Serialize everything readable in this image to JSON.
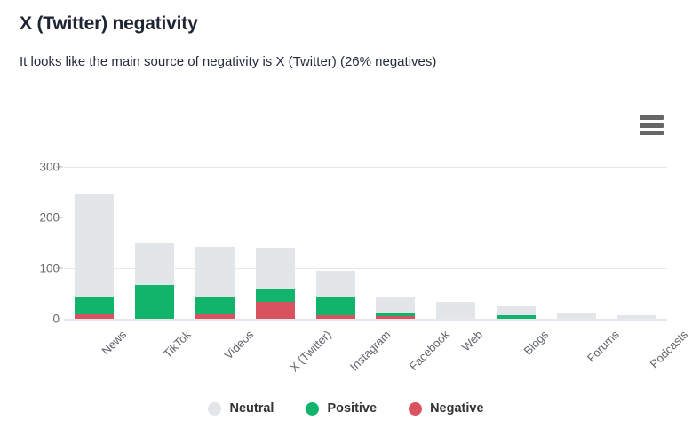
{
  "header": {
    "title": "X (Twitter) negativity",
    "subtitle": "It looks like the main source of negativity is X (Twitter) (26% negatives)"
  },
  "menu": {
    "icon": "hamburger-menu-icon",
    "label": "Chart context menu"
  },
  "colors": {
    "neutral": "#e3e6e9",
    "positive": "#11b46a",
    "negative": "#d9525f",
    "gridline": "#e8e8ea",
    "axis_text": "#6a6a6a",
    "title_text": "#1f2433"
  },
  "chart_data": {
    "type": "bar",
    "stacked": true,
    "title": "X (Twitter) negativity",
    "subtitle": "It looks like the main source of negativity is X (Twitter) (26% negatives)",
    "xlabel": "",
    "ylabel": "",
    "ylim": [
      0,
      320
    ],
    "yticks": [
      0,
      100,
      200,
      300
    ],
    "ytick_labels": [
      "0",
      "100",
      "200",
      "300"
    ],
    "grid": true,
    "legend_position": "bottom",
    "categories": [
      "News",
      "TikTok",
      "Videos",
      "X (Twitter)",
      "Instagram",
      "Facebook",
      "Web",
      "Blogs",
      "Forums",
      "Podcasts"
    ],
    "series": [
      {
        "name": "Neutral",
        "color": "#e3e6e9",
        "values": [
          204,
          84,
          101,
          81,
          51,
          30,
          33,
          18,
          11,
          7
        ]
      },
      {
        "name": "Positive",
        "color": "#11b46a",
        "values": [
          35,
          66,
          34,
          25,
          37,
          7,
          0,
          7,
          0,
          0
        ]
      },
      {
        "name": "Negative",
        "color": "#d9525f",
        "values": [
          9,
          0,
          8,
          34,
          7,
          5,
          0,
          0,
          0,
          0
        ]
      }
    ],
    "totals": [
      248,
      150,
      143,
      140,
      95,
      42,
      33,
      25,
      11,
      7
    ]
  },
  "legend": {
    "items": [
      {
        "label": "Neutral",
        "color": "#e3e6e9"
      },
      {
        "label": "Positive",
        "color": "#11b46a"
      },
      {
        "label": "Negative",
        "color": "#d9525f"
      }
    ]
  }
}
